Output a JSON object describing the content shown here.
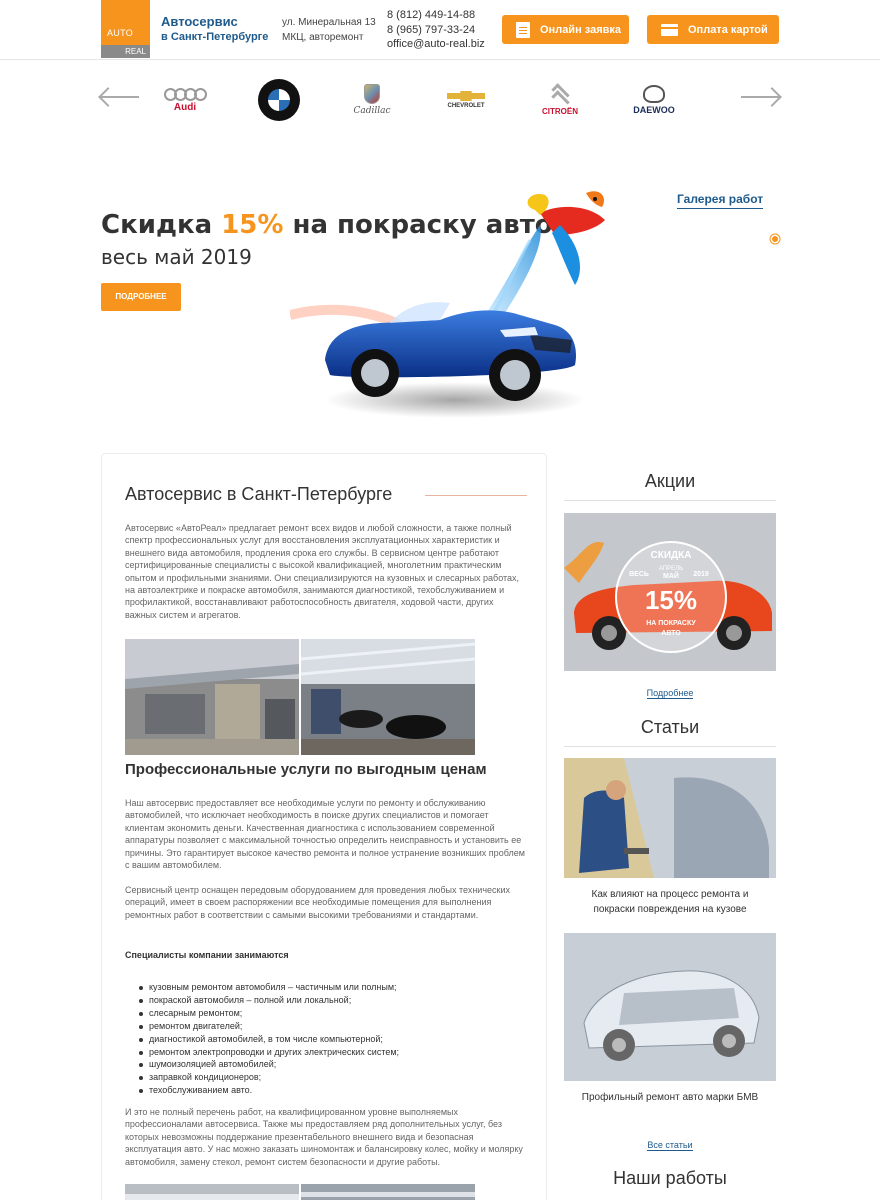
{
  "header": {
    "logo_top": "AUTO",
    "logo_bottom": "REAL",
    "brand_line1": "Автосервис",
    "brand_line2": "в Санкт-Петербурге",
    "address_line1": "ул. Минеральная 13",
    "address_line2": "МКЦ, авторемонт",
    "phone1": "8 (812) 449-14-88",
    "phone2": "8 (965) 797-33-24",
    "email": "office@auto-real.biz",
    "btn_request": "Онлайн заявка",
    "btn_pay": "Оплата картой"
  },
  "brands": {
    "audi": "Audi",
    "cadillac": "Cadillac",
    "chevrolet": "CHEVROLET",
    "citroen": "CITROËN",
    "daewoo": "DAEWOO"
  },
  "hero": {
    "title_before": "Скидка ",
    "title_highlight": "15%",
    "title_after": " на покраску авто",
    "subtitle": "весь май 2019",
    "button": "ПОДРОБНЕЕ",
    "gallery_link": "Галерея работ"
  },
  "main": {
    "title": "Автосервис в Санкт-Петербурге",
    "intro": "Автосервис «АвтоРеал» предлагает ремонт всех видов и любой сложности, а также полный спектр профессиональных услуг для восстановления эксплуатационных характеристик и внешнего вида автомобиля, продления срока его службы. В сервисном центре работают сертифицированные специалисты с высокой квалификацией, многолетним практическим опытом и профильными знаниями. Они специализируются на кузовных и слесарных работах, на автоэлектрике и покраске автомобиля, занимаются диагностикой, техобслуживанием и профилактикой, восстанавливают работоспособность двигателя, ходовой части, других важных систем и агрегатов.",
    "subtitle": "Профессиональные услуги по выгодным ценам",
    "para2": "Наш автосервис предоставляет все необходимые услуги по ремонту и обслуживанию автомобилей, что исключает необходимость в поиске других специалистов и помогает клиентам экономить деньги. Качественная диагностика с использованием современной аппаратуры позволяет с максимальной точностью определить неисправность и установить ее причины. Это гарантирует высокое качество ремонта и полное устранение возникших проблем с вашим автомобилем.",
    "para3": "Сервисный центр оснащен передовым оборудованием для проведения любых технических операций, имеет в своем распоряжении все необходимые помещения для выполнения ремонтных работ в соответствии с самыми высокими требованиями и стандартами.",
    "spec_heading": "Специалисты компании занимаются",
    "list": [
      "кузовным ремонтом автомобиля – частичным или полным;",
      "покраской автомобиля – полной или локальной;",
      "слесарным ремонтом;",
      "ремонтом двигателей;",
      "диагностикой автомобилей, в том числе компьютерной;",
      "ремонтом электропроводки и других электрических систем;",
      "шумоизоляцией автомобилей;",
      "заправкой кондиционеров;",
      "техобслуживанием авто."
    ],
    "para4": "И это не полный перечень работ, на квалифицированном уровне выполняемых профессионалами автосервиса. Также мы предоставляем ряд дополнительных услуг, без которых невозможны поддержание презентабельного внешнего вида и безопасная эксплуатация авто. У нас можно заказать шиномонтаж и балансировку колес, мойку и молярку автомобиля, замену стекол, ремонт систем безопасности и другие работы."
  },
  "sidebar": {
    "promo_title": "Акции",
    "promo_badge": {
      "skidka": "СКИДКА",
      "ves": "ВЕСЬ",
      "aprel": "АПРЕЛЬ",
      "mai": "МАЙ",
      "year": "2019",
      "percent": "15%",
      "na_pokrasku": "НА ПОКРАСКУ",
      "avto": "АВТО"
    },
    "promo_link": "Подробнее",
    "articles_title": "Статьи",
    "article1": "Как влияют на процесс ремонта и покраски повреждения на кузове",
    "article2": "Профильный ремонт авто марки БМВ",
    "all_articles": "Все статьи",
    "works_title": "Наши работы"
  },
  "colors": {
    "accent": "#f7941d",
    "link": "#1f5a8c",
    "text": "#333333"
  }
}
